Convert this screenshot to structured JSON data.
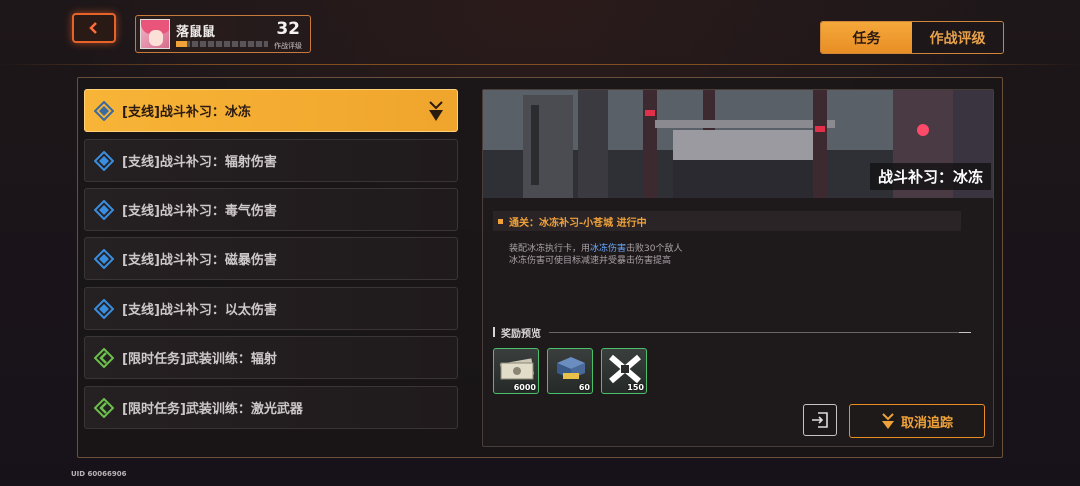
{
  "header": {
    "back_icon": "chevron-left-icon",
    "player": {
      "name": "落鼠鼠",
      "level": "32",
      "subtitle": "作战评级",
      "progress": 0.12
    },
    "tabs": [
      {
        "label": "任务",
        "active": true
      },
      {
        "label": "作战评级",
        "active": false
      }
    ]
  },
  "tasks": [
    {
      "label": "[支线]战斗补习：冰冻",
      "icon": "diamond-quest-icon",
      "active": true
    },
    {
      "label": "[支线]战斗补习：辐射伤害",
      "icon": "diamond-quest-icon",
      "active": false
    },
    {
      "label": "[支线]战斗补习：毒气伤害",
      "icon": "diamond-quest-icon",
      "active": false
    },
    {
      "label": "[支线]战斗补习：磁暴伤害",
      "icon": "diamond-quest-icon",
      "active": false
    },
    {
      "label": "[支线]战斗补习：以太伤害",
      "icon": "diamond-quest-icon",
      "active": false
    },
    {
      "label": "[限时任务]武装训练：辐射",
      "icon": "timed-quest-icon",
      "active": false
    },
    {
      "label": "[限时任务]武装训练：激光武器",
      "icon": "timed-quest-icon",
      "active": false
    }
  ],
  "detail": {
    "banner_title": "战斗补习：冰冻",
    "objective": "通关：冰冻补习-小苍城 进行中",
    "desc_line1_pre": "装配冰冻执行卡，用",
    "desc_line1_hl": "冰冻伤害",
    "desc_line1_post": "击败30个敌人",
    "desc_line2": "冰冻伤害可使目标减速并受暴击伤害提高",
    "reward_title": "奖励预览",
    "rewards": [
      {
        "icon": "cash-bundle-icon",
        "count": "6000"
      },
      {
        "icon": "material-stack-icon",
        "count": "60"
      },
      {
        "icon": "crossed-tools-icon",
        "count": "150"
      }
    ],
    "untrack_label": "取消追踪"
  },
  "footer": {
    "uid": "UID 60066906"
  },
  "colors": {
    "accent": "#f0a23a",
    "highlight": "#6aa8ff",
    "reward_border": "#4bc06a"
  }
}
